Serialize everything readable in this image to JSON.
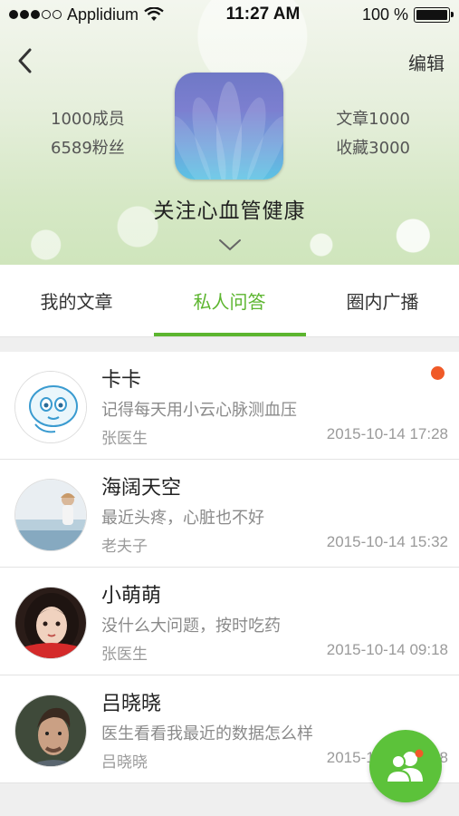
{
  "status_bar": {
    "carrier": "Applidium",
    "time": "11:27 AM",
    "battery": "100 %",
    "signal_dots_filled": 3,
    "signal_dots_total": 5
  },
  "header": {
    "edit_label": "编辑",
    "left_stats": [
      "1000成员",
      "6589粉丝"
    ],
    "right_stats": [
      "文章1000",
      "收藏3000"
    ],
    "group_name": "关注心血管健康"
  },
  "tabs": [
    {
      "label": "我的文章",
      "active": false
    },
    {
      "label": "私人问答",
      "active": true
    },
    {
      "label": "圈内广播",
      "active": false
    }
  ],
  "messages": [
    {
      "name": "卡卡",
      "message": "记得每天用小云心脉测血压",
      "author": "张医生",
      "time": "2015-10-14 17:28",
      "unread": true
    },
    {
      "name": "海阔天空",
      "message": "最近头疼，心脏也不好",
      "author": "老夫子",
      "time": "2015-10-14 15:32",
      "unread": false
    },
    {
      "name": "小萌萌",
      "message": "没什么大问题，按时吃药",
      "author": "张医生",
      "time": "2015-10-14 09:18",
      "unread": false
    },
    {
      "name": "吕晓晓",
      "message": "医生看看我最近的数据怎么样",
      "author": "吕晓晓",
      "time": "2015-10-14 17:28",
      "unread": false
    }
  ],
  "colors": {
    "accent": "#5cb52f",
    "unread": "#f05a28",
    "fab": "#5cc23a"
  },
  "icons": {
    "back": "chevron-left-icon",
    "expand": "chevron-down-icon",
    "fab": "contacts-icon"
  }
}
